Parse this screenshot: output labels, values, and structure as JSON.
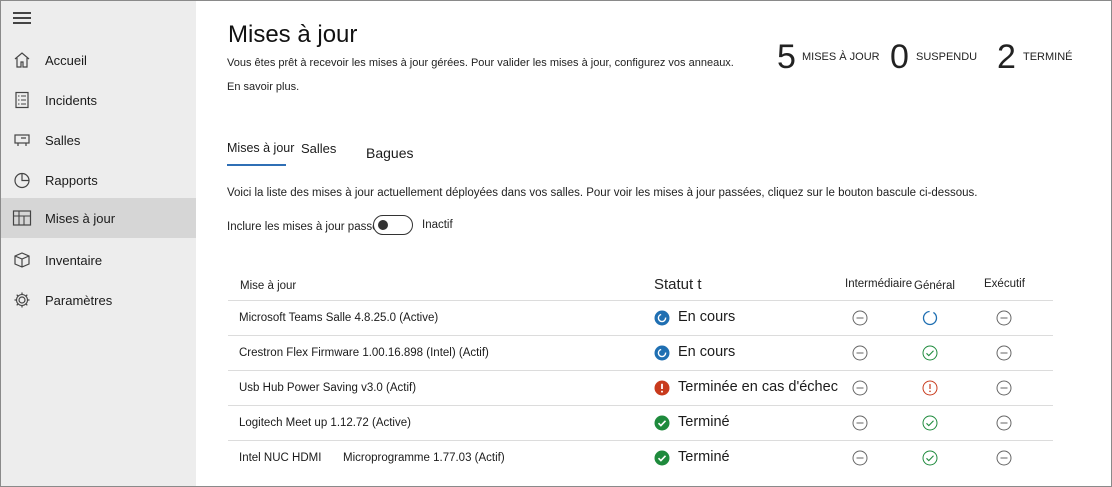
{
  "sidebar": {
    "menu_icon": "hamburger-icon",
    "items": [
      {
        "label": "Accueil",
        "icon": "home-icon"
      },
      {
        "label": "Incidents",
        "icon": "checklist-icon"
      },
      {
        "label": "Salles",
        "icon": "room-icon"
      },
      {
        "label": "Rapports",
        "icon": "pie-chart-icon"
      },
      {
        "label": "Mises à jour",
        "icon": "updates-icon",
        "active": true
      },
      {
        "label": "Inventaire",
        "icon": "box-icon"
      },
      {
        "label": "Paramètres",
        "icon": "gear-icon"
      }
    ]
  },
  "main": {
    "title": "Mises à jour",
    "intro": "Vous êtes prêt à recevoir les mises à jour gérées. Pour valider les mises à jour, configurez vos anneaux.",
    "learn_more": "En savoir plus.",
    "counters": [
      {
        "value": "5",
        "label": "MISES À JOUR"
      },
      {
        "value": "0",
        "label": "SUSPENDU"
      },
      {
        "value": "2",
        "label": "TERMINÉ"
      }
    ],
    "tabs": [
      {
        "label": "Mises à jour"
      },
      {
        "label": "Salles"
      },
      {
        "label": "Bagues"
      }
    ],
    "description": "Voici la liste des mises à jour actuellement déployées dans vos salles. Pour voir les mises à jour passées, cliquez sur le bouton bascule ci-dessous.",
    "toggle": {
      "label": "Inclure les mises à jour passées",
      "state": "Inactif",
      "on": false
    },
    "table": {
      "headers": {
        "update": "Mise à jour",
        "status": "Statut t",
        "ring1": "Intermédiaire",
        "ring2": "Général",
        "ring3": "Exécutif"
      },
      "rows": [
        {
          "name": "Microsoft Teams Salle 4.8.25.0 (Active)",
          "name_extra": "",
          "status": "En cours",
          "status_kind": "progress",
          "rings": [
            "not-started",
            "in-progress",
            "not-started"
          ]
        },
        {
          "name": "Crestron Flex Firmware 1.00.16.898 (Intel) (Actif)",
          "name_extra": "",
          "status": "En cours",
          "status_kind": "progress",
          "rings": [
            "not-started",
            "done",
            "not-started"
          ]
        },
        {
          "name": "Usb Hub Power Saving v3.0 (Actif)",
          "name_extra": "",
          "status": "Terminée en cas d'échec",
          "status_kind": "failed",
          "rings": [
            "not-started",
            "failed",
            "not-started"
          ]
        },
        {
          "name": "Logitech Meet up 1.12.72 (Active)",
          "name_extra": "",
          "status": "Terminé",
          "status_kind": "done",
          "rings": [
            "not-started",
            "done",
            "not-started"
          ]
        },
        {
          "name": "Intel NUC HDMI",
          "name_extra": "Microprogramme 1.77.03 (Actif)",
          "status": "Terminé",
          "status_kind": "done",
          "rings": [
            "not-started",
            "done",
            "not-started"
          ]
        }
      ]
    }
  },
  "colors": {
    "sidebar_bg": "#ededed",
    "sidebar_active": "#d6d6d6",
    "accent": "#2f6fb5",
    "progress": "#1f6fb2",
    "success": "#1e8a3c",
    "error": "#c83a1c"
  }
}
